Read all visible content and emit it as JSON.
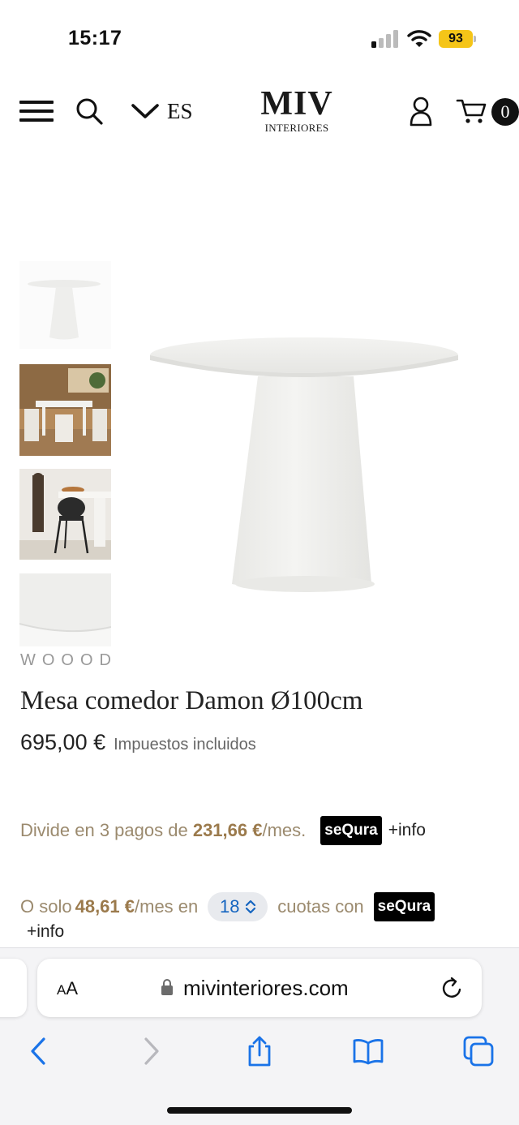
{
  "status_bar": {
    "time": "15:17",
    "battery": "93"
  },
  "header": {
    "language": "ES",
    "logo_main": "MIV",
    "logo_sub": "INTERIORES",
    "cart_count": "0"
  },
  "gallery": {
    "thumbnails": [
      "product-white-table",
      "dining-room-scene",
      "table-with-chair-and-sculpture",
      "tabletop-closeup"
    ]
  },
  "product": {
    "brand": "WOOOD",
    "title": "Mesa comedor Damon Ø100cm",
    "price": "695,00 €",
    "tax_note": "Impuestos incluidos"
  },
  "financing": {
    "split_prefix": "Divide en 3 pagos de",
    "split_amount": "231,66 €",
    "split_suffix": "/mes.",
    "provider": "seQura",
    "info_link": "+info",
    "quota_prefix": "O solo",
    "quota_amount": "48,61 €",
    "quota_mid": "/mes en",
    "quota_selected": "18",
    "quota_suffix": "cuotas con",
    "info_link_2": "+info"
  },
  "browser": {
    "text_size_label": "AA",
    "url": "mivinteriores.com"
  },
  "colors": {
    "financing_text": "#9b8a6e",
    "financing_amount": "#9b7a4c",
    "quota_select_text": "#1565c0",
    "browser_icon": "#1a73e8",
    "battery": "#f5c518"
  }
}
